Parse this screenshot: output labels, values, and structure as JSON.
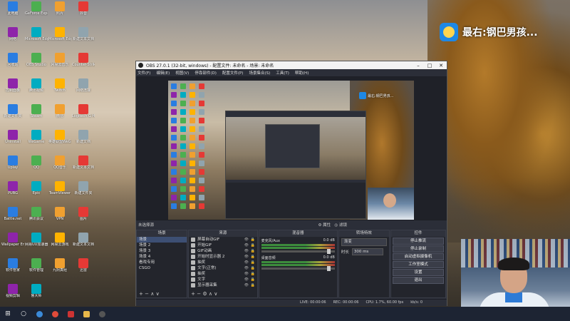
{
  "desktop": {
    "icons": [
      {
        "label": "此电脑"
      },
      {
        "label": "GeForce Experience"
      },
      {
        "label": "照片"
      },
      {
        "label": "抖音"
      },
      {
        "label": "网络"
      },
      {
        "label": "Microsoft Edge"
      },
      {
        "label": "Microsoft Edge"
      },
      {
        "label": "新建文本文档"
      },
      {
        "label": "回收站"
      },
      {
        "label": "OBS Studio"
      },
      {
        "label": "网易云音乐"
      },
      {
        "label": "Counter-Strike Global Offensive"
      },
      {
        "label": "控制面板"
      },
      {
        "label": "腾讯视频"
      },
      {
        "label": "Twitch"
      },
      {
        "label": "网络连接"
      },
      {
        "label": "新建文件夹"
      },
      {
        "label": "Steam"
      },
      {
        "label": "微信"
      },
      {
        "label": "Logitech G HUB"
      },
      {
        "label": "Uninstall"
      },
      {
        "label": "WeGame"
      },
      {
        "label": "英雄联盟WeGame版"
      },
      {
        "label": "新建文档"
      },
      {
        "label": "Uplay"
      },
      {
        "label": "QQ"
      },
      {
        "label": "QQ音乐"
      },
      {
        "label": "新建文本文档"
      },
      {
        "label": "PUBG"
      },
      {
        "label": "Epic"
      },
      {
        "label": "TeamViewer"
      },
      {
        "label": "新建文件夹"
      },
      {
        "label": "Battle.net"
      },
      {
        "label": "腾讯会议"
      },
      {
        "label": "VPN"
      },
      {
        "label": "图片"
      },
      {
        "label": "Wallpaper Engine"
      },
      {
        "label": "网易UU加速器"
      },
      {
        "label": "网易云游戏"
      },
      {
        "label": "新建文本文档"
      },
      {
        "label": "软件管家"
      },
      {
        "label": "软件管理"
      },
      {
        "label": "九阴真经"
      },
      {
        "label": "迅雷"
      },
      {
        "label": "视频剪辑"
      },
      {
        "label": "鲁大师"
      }
    ]
  },
  "overlay": {
    "logo_text": "最右:钢巴男孩..."
  },
  "obs": {
    "title": "OBS 27.0.1 (32-bit, windows) - 配置文件: 未命名 - 场景: 未命名",
    "menu": [
      "文件(F)",
      "编辑(E)",
      "视图(V)",
      "停靠部件(D)",
      "配置文件(P)",
      "场景集合(S)",
      "工具(T)",
      "帮助(H)"
    ],
    "canvas_logo": "最右:钢巴男孩...",
    "source_bar": {
      "label": "未选择源",
      "props": "属性",
      "filters": "滤镜"
    },
    "scenes": {
      "header": "场景",
      "items": [
        "场景",
        "场景 2",
        "场景 3",
        "场景 4",
        "看戏专用",
        "CSGO"
      ]
    },
    "sources": {
      "header": "来源",
      "items": [
        "屏幕自动GIF",
        "开始GIF",
        "GIF动画",
        "开始时显示器 2",
        "抽奖",
        "文字(正常)",
        "抽奖",
        "文字",
        "显示器采集"
      ]
    },
    "mixer": {
      "header": "混音器",
      "channels": [
        {
          "name": "麦克风/Aux",
          "db": "0.0 dB"
        },
        {
          "name": "桌面音频",
          "db": "0.0 dB"
        }
      ]
    },
    "transitions": {
      "header": "转场特效",
      "selected": "渐变",
      "duration_label": "时长",
      "duration": "300 ms"
    },
    "controls": {
      "header": "控件",
      "buttons": [
        "停止推流",
        "停止录制",
        "启动虚拟摄像机",
        "工作室模式",
        "设置",
        "退出"
      ]
    },
    "status": {
      "dropped": "LIVE: 00:00:06",
      "rec": "REC: 00:00:06",
      "cpu": "CPU: 1.7%, 60.00 fps",
      "kbps": "kb/s: 0"
    }
  },
  "taskbar": {
    "items": [
      "start-icon",
      "search-icon",
      "chrome-icon",
      "edge-icon",
      "app-icon",
      "folder-icon",
      "obs-icon"
    ]
  }
}
